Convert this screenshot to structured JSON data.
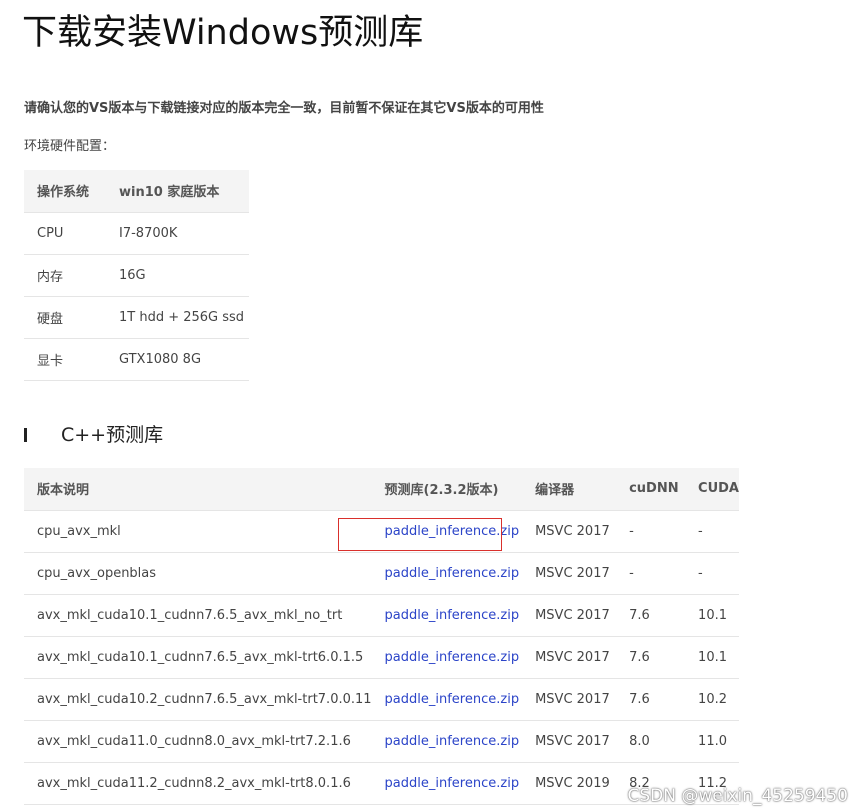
{
  "page": {
    "title": "下载安装Windows预测库",
    "notice": "请确认您的VS版本与下载链接对应的版本完全一致，目前暂不保证在其它VS版本的可用性",
    "env_label": "环境硬件配置："
  },
  "hardware": {
    "header": [
      "操作系统",
      "win10 家庭版本"
    ],
    "rows": [
      [
        "CPU",
        "I7-8700K"
      ],
      [
        "内存",
        "16G"
      ],
      [
        "硬盘",
        "1T hdd + 256G ssd"
      ],
      [
        "显卡",
        "GTX1080 8G"
      ]
    ]
  },
  "cpp_section": {
    "heading": "C++预测库",
    "columns": [
      "版本说明",
      "预测库(2.3.2版本)",
      "编译器",
      "cuDNN",
      "CUDA"
    ],
    "rows": [
      [
        "cpu_avx_mkl",
        "paddle_inference.zip",
        "MSVC 2017",
        "-",
        "-"
      ],
      [
        "cpu_avx_openblas",
        "paddle_inference.zip",
        "MSVC 2017",
        "-",
        "-"
      ],
      [
        "avx_mkl_cuda10.1_cudnn7.6.5_avx_mkl_no_trt",
        "paddle_inference.zip",
        "MSVC 2017",
        "7.6",
        "10.1"
      ],
      [
        "avx_mkl_cuda10.1_cudnn7.6.5_avx_mkl-trt6.0.1.5",
        "paddle_inference.zip",
        "MSVC 2017",
        "7.6",
        "10.1"
      ],
      [
        "avx_mkl_cuda10.2_cudnn7.6.5_avx_mkl-trt7.0.0.11",
        "paddle_inference.zip",
        "MSVC 2017",
        "7.6",
        "10.2"
      ],
      [
        "avx_mkl_cuda11.0_cudnn8.0_avx_mkl-trt7.2.1.6",
        "paddle_inference.zip",
        "MSVC 2017",
        "8.0",
        "11.0"
      ],
      [
        "avx_mkl_cuda11.2_cudnn8.2_avx_mkl-trt8.0.1.6",
        "paddle_inference.zip",
        "MSVC 2019",
        "8.2",
        "11.2"
      ]
    ]
  },
  "watermark": "CSDN @weixin_45259450",
  "colors": {
    "link": "#2b44c8",
    "highlight_border": "#d9302c",
    "header_bg": "#f4f4f4"
  }
}
